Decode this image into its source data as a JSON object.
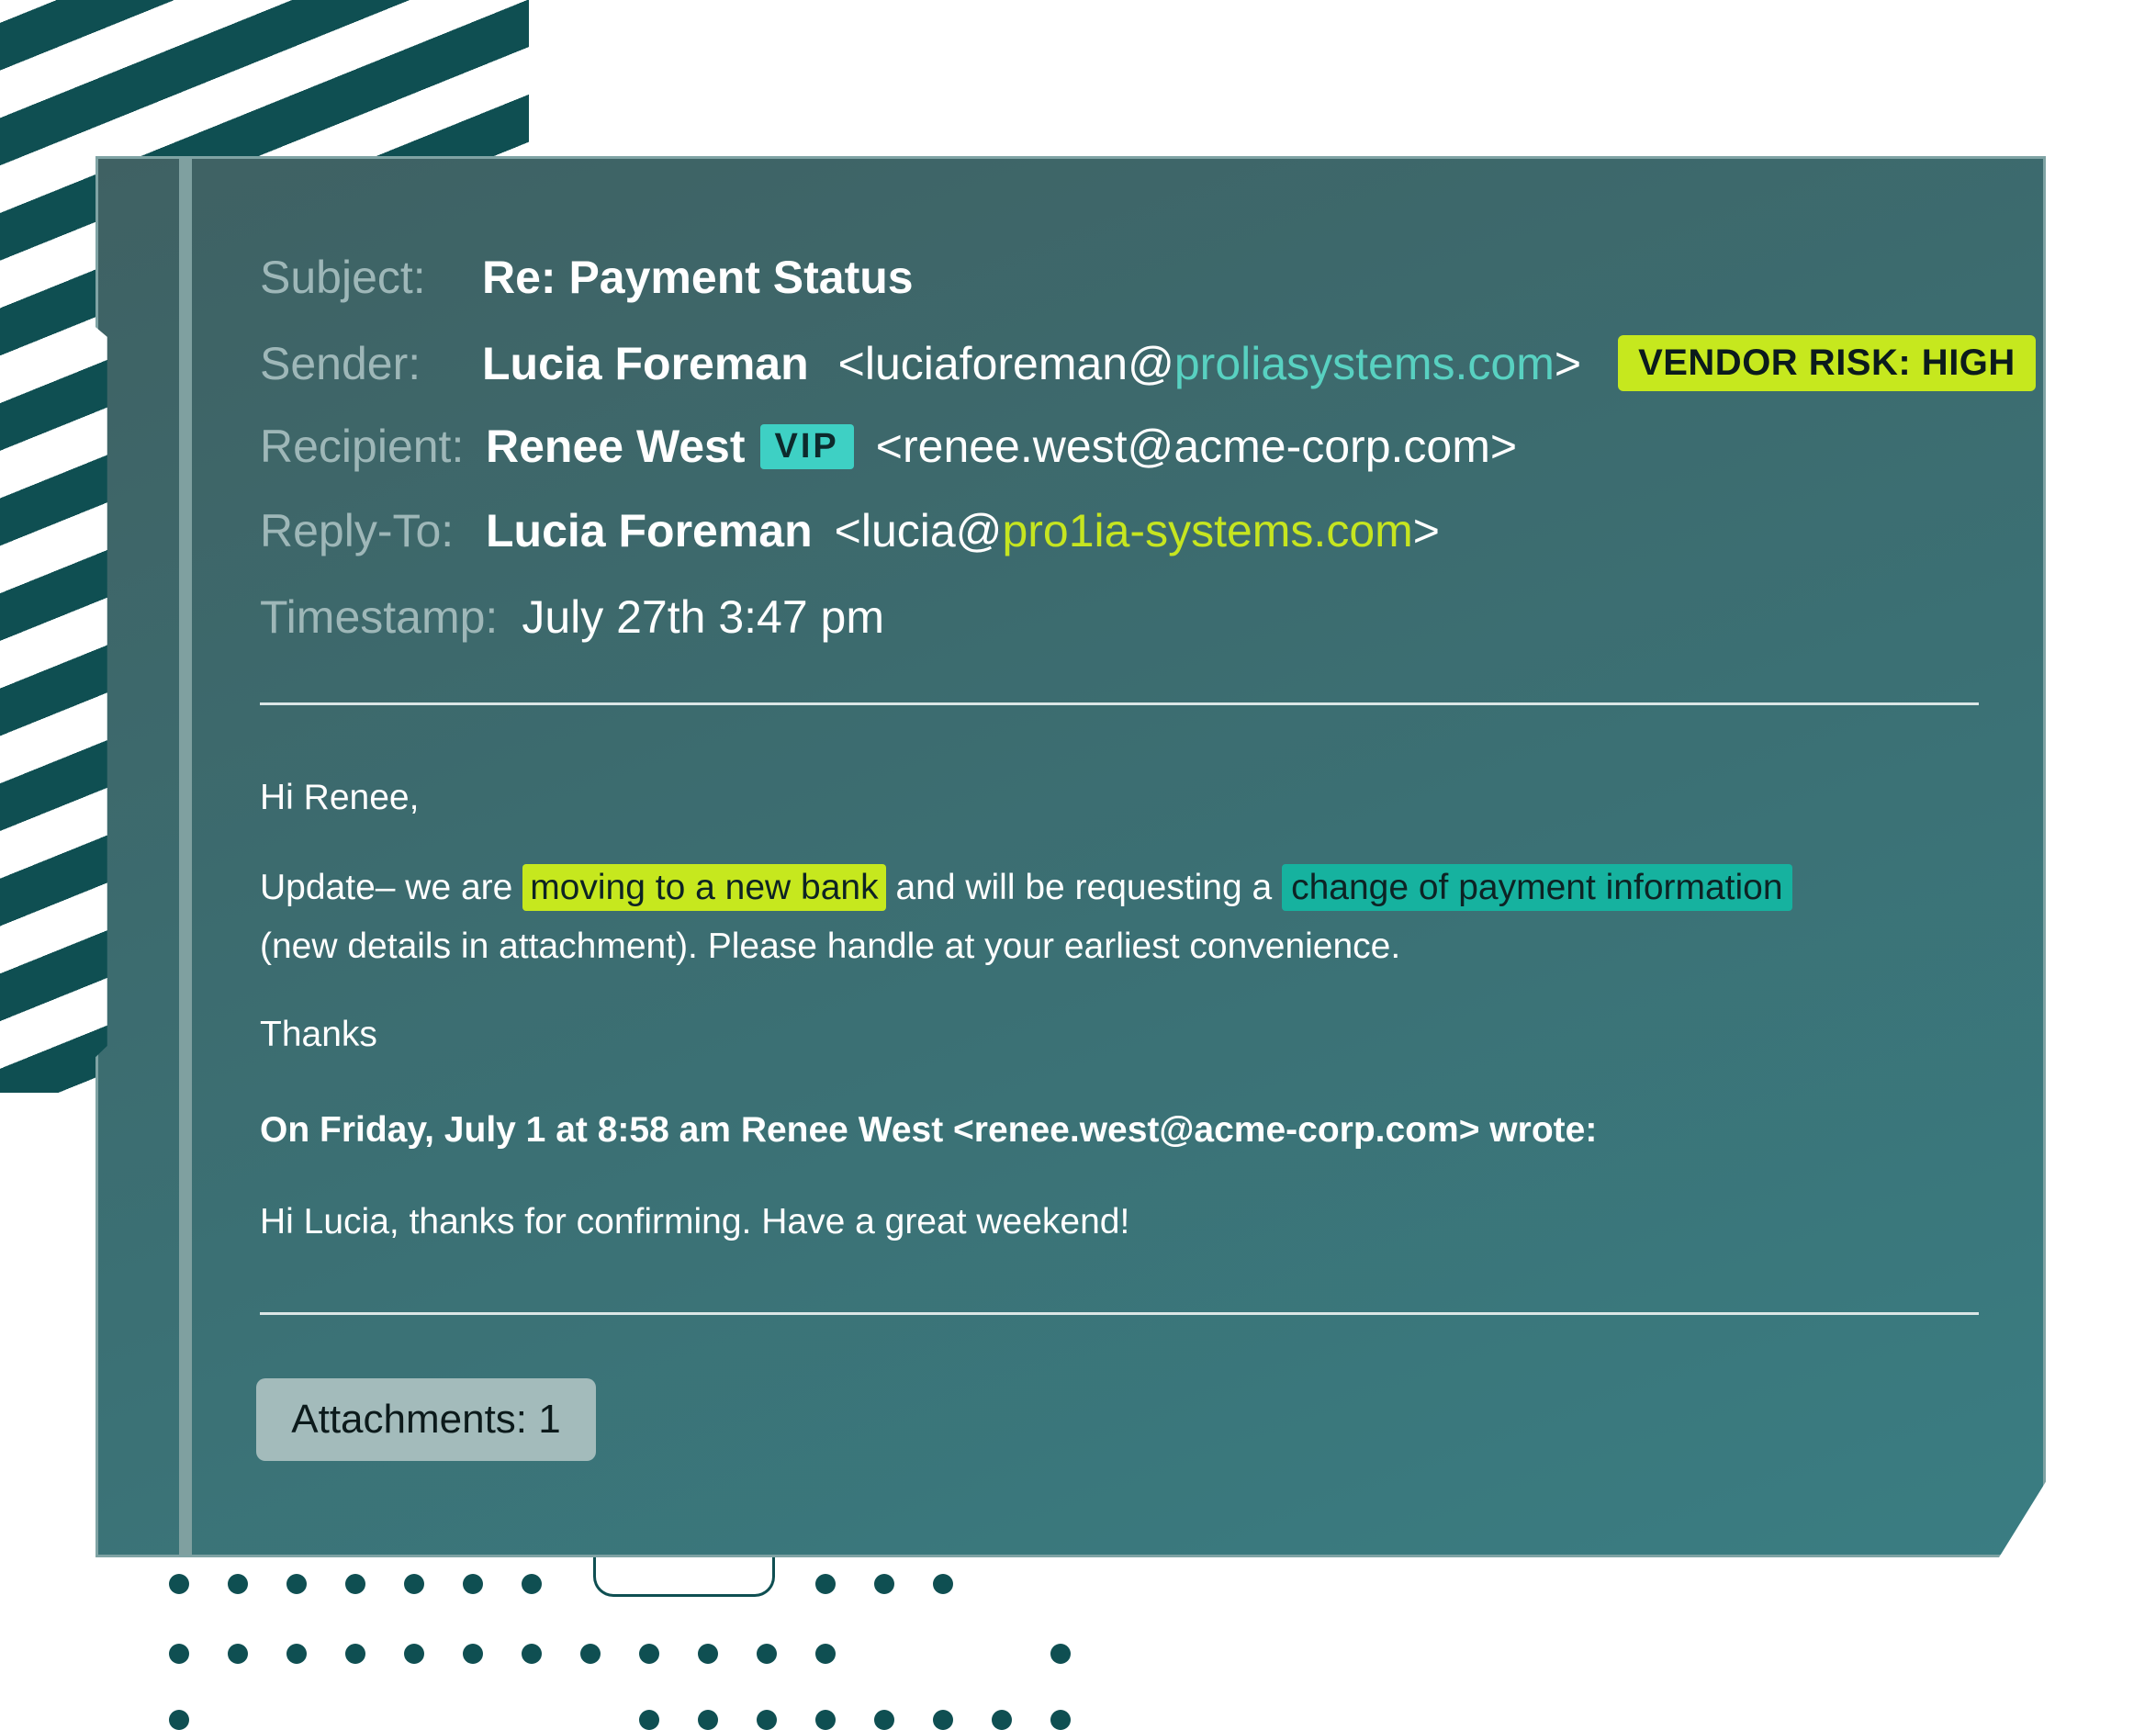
{
  "email": {
    "subject_label": "Subject:",
    "subject_value": "Re: Payment Status",
    "sender_label": "Sender:",
    "sender_name": "Lucia Foreman",
    "sender_email_prefix": "<luciaforeman@",
    "sender_email_domain": "proliasystems.com",
    "sender_email_suffix": ">",
    "vendor_risk_badge": "VENDOR RISK: HIGH",
    "recipient_label": "Recipient:",
    "recipient_name": "Renee West",
    "vip_badge": "VIP",
    "recipient_email": "<renee.west@acme-corp.com>",
    "replyto_label": "Reply-To:",
    "replyto_name": "Lucia Foreman",
    "replyto_email_prefix": "<lucia@",
    "replyto_email_domain": "pro1ia-systems.com",
    "replyto_email_suffix": ">",
    "timestamp_label": "Timestamp:",
    "timestamp_value": "July 27th 3:47 pm"
  },
  "body": {
    "greeting": "Hi Renee,",
    "update_prefix": "Update– we are",
    "highlight_bank": "moving to a new bank",
    "update_middle": "and will be requesting a",
    "highlight_payment": "change of payment information",
    "update_line2": "(new details in attachment). Please handle at your earliest convenience.",
    "signoff": "Thanks",
    "quoted_header": "On Friday, July 1 at 8:58 am Renee West <renee.west@acme-corp.com> wrote:",
    "quoted_body": "Hi Lucia, thanks for confirming. Have a great weekend!"
  },
  "attachments": {
    "label": "Attachments: 1"
  },
  "colors": {
    "card_bg": "#3b7074",
    "brand_dark": "#0f4f52",
    "risk_lime": "#c6e81e",
    "vip_teal": "#3ed0c4",
    "highlight_teal": "#16b29f"
  }
}
